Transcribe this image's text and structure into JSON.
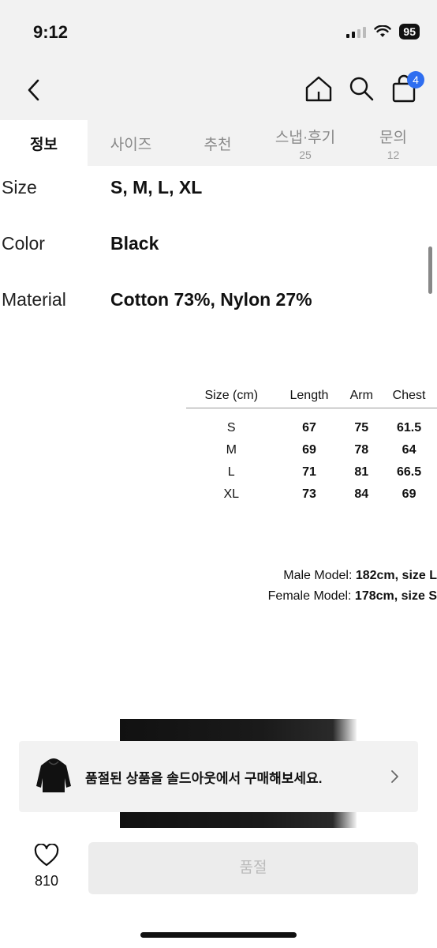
{
  "status_bar": {
    "time": "9:12",
    "battery": "95"
  },
  "header": {
    "cart_count": "4"
  },
  "tabs": [
    {
      "label": "정보",
      "count": ""
    },
    {
      "label": "사이즈",
      "count": ""
    },
    {
      "label": "추천",
      "count": ""
    },
    {
      "label": "스냅·후기",
      "count": "25"
    },
    {
      "label": "문의",
      "count": "12"
    }
  ],
  "info": [
    {
      "label": "Size",
      "value": "S, M, L, XL"
    },
    {
      "label": "Color",
      "value": "Black"
    },
    {
      "label": "Material",
      "value": "Cotton 73%, Nylon 27%"
    }
  ],
  "size_table": {
    "headers": [
      "Size (cm)",
      "Length",
      "Arm",
      "Chest"
    ],
    "rows": [
      [
        "S",
        "67",
        "75",
        "61.5"
      ],
      [
        "M",
        "69",
        "78",
        "64"
      ],
      [
        "L",
        "71",
        "81",
        "66.5"
      ],
      [
        "XL",
        "73",
        "84",
        "69"
      ]
    ]
  },
  "models": {
    "male_prefix": "Male Model: ",
    "male_value": "182cm, size L",
    "female_prefix": "Female Model: ",
    "female_value": "178cm, size S"
  },
  "soldout_banner": {
    "text": "품절된 상품을 솔드아웃에서 구매해보세요."
  },
  "bottom_bar": {
    "like_count": "810",
    "buy_label": "품절"
  },
  "colors": {
    "accent_badge": "#2f6ef0",
    "header_bg": "#f2f2f2"
  }
}
